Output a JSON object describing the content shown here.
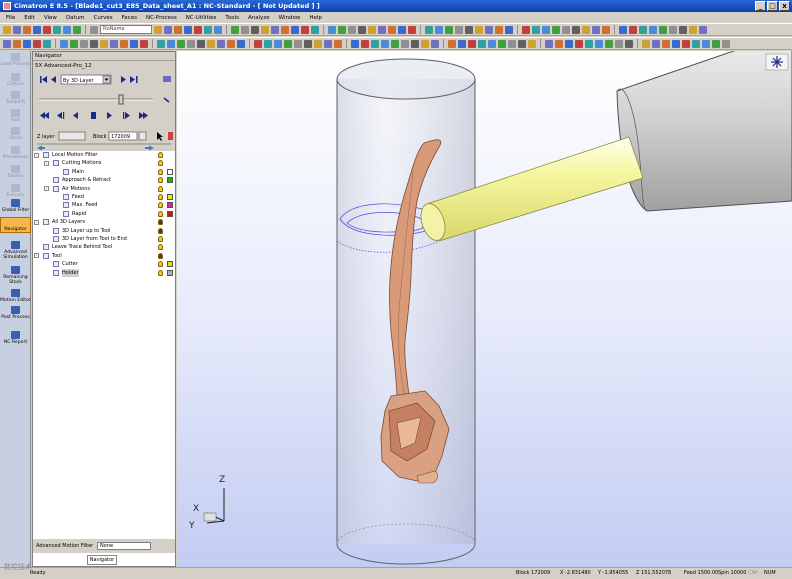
{
  "window": {
    "title": "Cimatron E 8.5 - [Blade1_cut3_E85_Data_sheet_A1 : NC-Standard - [ Not Updated ] ]",
    "controls": [
      "_",
      "□",
      "x"
    ]
  },
  "menubar": [
    "File",
    "Edit",
    "View",
    "Datum",
    "Curves",
    "Faces",
    "NC-Process",
    "NC-Utilities",
    "Tools",
    "Analyze",
    "Window",
    "Help"
  ],
  "toolbar": {
    "combo_label": "NoName",
    "combo_label2": ""
  },
  "sidebar": {
    "items": [
      {
        "label": "Load Process",
        "state": "dim"
      },
      {
        "label": "Cutters",
        "state": "dim"
      },
      {
        "label": "Toolpath",
        "state": "dim"
      },
      {
        "label": "Part",
        "state": "dim"
      },
      {
        "label": "Stock",
        "state": "dim"
      },
      {
        "label": "Procedures",
        "state": "dim"
      },
      {
        "label": "Delete",
        "state": "dim"
      },
      {
        "label": "Execute",
        "state": "dim"
      },
      {
        "label": "Global Filter",
        "state": "on"
      },
      {
        "label": "Navigator",
        "state": "selected"
      },
      {
        "label": "Advanced Simulation",
        "state": "on"
      },
      {
        "label": "Remaining Stock",
        "state": "on"
      },
      {
        "label": "Motion Editor",
        "state": "on"
      },
      {
        "label": "Post Process",
        "state": "on"
      },
      {
        "label": "NC Report",
        "state": "on"
      }
    ]
  },
  "navigator": {
    "title": "Navigator",
    "procedure": "5X Advanced-Pro_12",
    "layer_mode": "By 3D Layer",
    "z_layer_label": "Z layer",
    "block_label": "Block",
    "block_value": "172009",
    "tree": [
      {
        "label": "Local Motion Filter",
        "indent": 0,
        "twisty": "-",
        "bulb": true,
        "swatch": ""
      },
      {
        "label": "Cutting Motions",
        "indent": 1,
        "twisty": "-",
        "bulb": true,
        "swatch": ""
      },
      {
        "label": "Main",
        "indent": 2,
        "twisty": "",
        "bulb": true,
        "swatch": "#ffffff"
      },
      {
        "label": "Approach & Retract",
        "indent": 1,
        "twisty": "",
        "bulb": true,
        "swatch": "#00c000"
      },
      {
        "label": "Air Motions",
        "indent": 1,
        "twisty": "-",
        "bulb": true,
        "swatch": ""
      },
      {
        "label": "Feed",
        "indent": 2,
        "twisty": "",
        "bulb": true,
        "swatch": "#e8e800"
      },
      {
        "label": "Max. Feed",
        "indent": 2,
        "twisty": "",
        "bulb": true,
        "swatch": "#e020a0"
      },
      {
        "label": "Rapid",
        "indent": 2,
        "twisty": "",
        "bulb": true,
        "swatch": "#d01010"
      },
      {
        "label": "All 3D Layers",
        "indent": 0,
        "twisty": "-",
        "bulb": true,
        "swatch": ""
      },
      {
        "label": "3D Layer up to Tool",
        "indent": 1,
        "twisty": "",
        "bulb": true,
        "swatch": ""
      },
      {
        "label": "3D Layer from Tool to End",
        "indent": 1,
        "twisty": "",
        "bulb": true,
        "swatch": ""
      },
      {
        "label": "Leave Trace Behind Tool",
        "indent": 0,
        "twisty": "",
        "bulb": true,
        "swatch": ""
      },
      {
        "label": "Tool",
        "indent": 0,
        "twisty": "-",
        "bulb": true,
        "swatch": ""
      },
      {
        "label": "Cutter",
        "indent": 1,
        "twisty": "",
        "bulb": true,
        "swatch": "#e0e000"
      },
      {
        "label": "Holder",
        "indent": 1,
        "twisty": "",
        "bulb": true,
        "swatch": "#b0b0b0",
        "highlight": true
      }
    ],
    "filter_label": "Advanced Motion Filter",
    "filter_value": "None",
    "tab": "Navigator"
  },
  "viewport": {
    "axis_labels": {
      "x": "X",
      "y": "Y",
      "z": "Z"
    },
    "tool_colors": {
      "cutter": "#f4f48c",
      "holder": "#d8d8d8",
      "part": "#d99a7a",
      "stock_outline": "#606060"
    }
  },
  "status": {
    "ready": "Ready",
    "block": "Block  172009",
    "x": "X  -2.831480",
    "y": "Y  -1.954055",
    "z": "Z  151.552078",
    "feed": "Feed  1500.00",
    "spin": "Spin  10000",
    "cap": "CAP",
    "num": "NUM"
  },
  "watermark": "数控技术"
}
